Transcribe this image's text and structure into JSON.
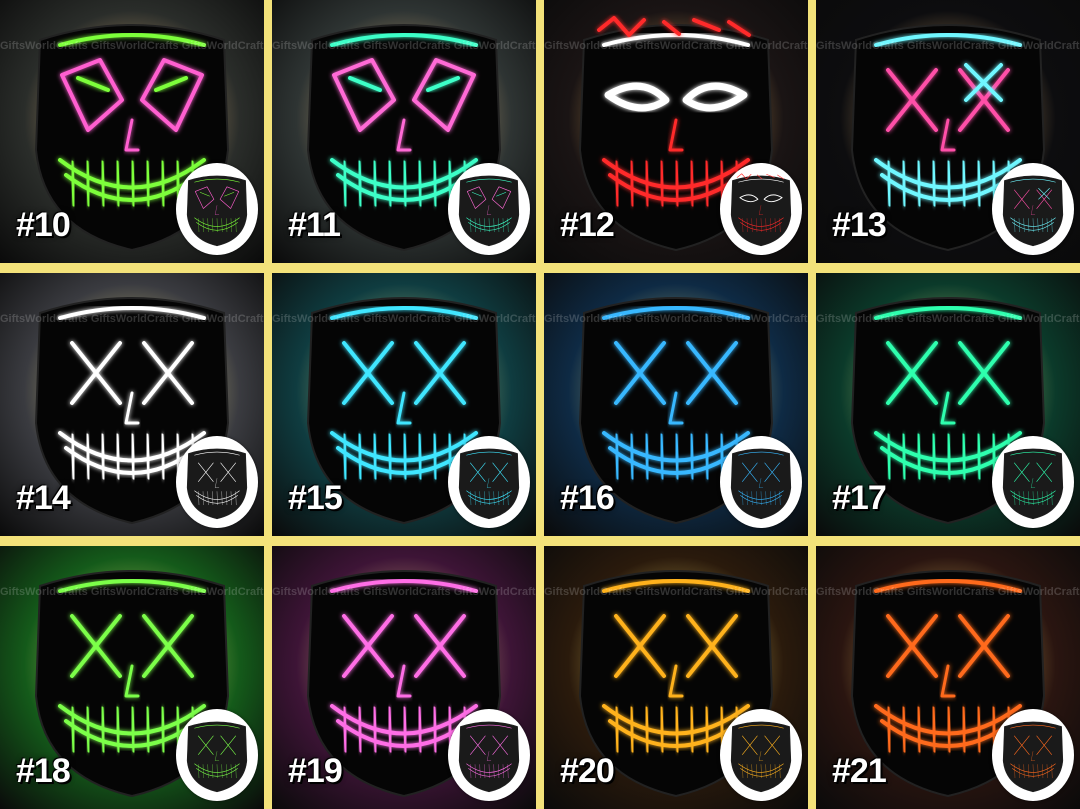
{
  "watermark": "GiftsWorldCrafts",
  "tiles": [
    {
      "label": "#10",
      "bg": "#2a2d2a",
      "main": "#ff5fd0",
      "accent": "#7dff3a",
      "style": "joker"
    },
    {
      "label": "#11",
      "bg": "#2e3433",
      "main": "#ff6ad6",
      "accent": "#3dffc8",
      "style": "clown"
    },
    {
      "label": "#12",
      "bg": "#1a1414",
      "main": "#ff2a2a",
      "accent": "#ffffff",
      "style": "kissme"
    },
    {
      "label": "#13",
      "bg": "#0d0d0f",
      "main": "#ff4fa8",
      "accent": "#6ff7ff",
      "style": "split"
    },
    {
      "label": "#14",
      "bg": "#3a3b40",
      "main": "#ffffff",
      "accent": "#ffffff",
      "style": "x"
    },
    {
      "label": "#15",
      "bg": "#0f3c40",
      "main": "#3fe6ff",
      "accent": "#3fe6ff",
      "style": "x"
    },
    {
      "label": "#16",
      "bg": "#0e2a44",
      "main": "#37b8ff",
      "accent": "#37b8ff",
      "style": "x"
    },
    {
      "label": "#17",
      "bg": "#0b3a2a",
      "main": "#2dffae",
      "accent": "#2dffae",
      "style": "x"
    },
    {
      "label": "#18",
      "bg": "#145a1a",
      "main": "#7bff4a",
      "accent": "#7bff4a",
      "style": "x"
    },
    {
      "label": "#19",
      "bg": "#3d1436",
      "main": "#ff6ee6",
      "accent": "#ff6ee6",
      "style": "x"
    },
    {
      "label": "#20",
      "bg": "#2a1a0c",
      "main": "#ffb21e",
      "accent": "#ffb21e",
      "style": "x"
    },
    {
      "label": "#21",
      "bg": "#2a1510",
      "main": "#ff6a1e",
      "accent": "#ff6a1e",
      "style": "x"
    }
  ]
}
